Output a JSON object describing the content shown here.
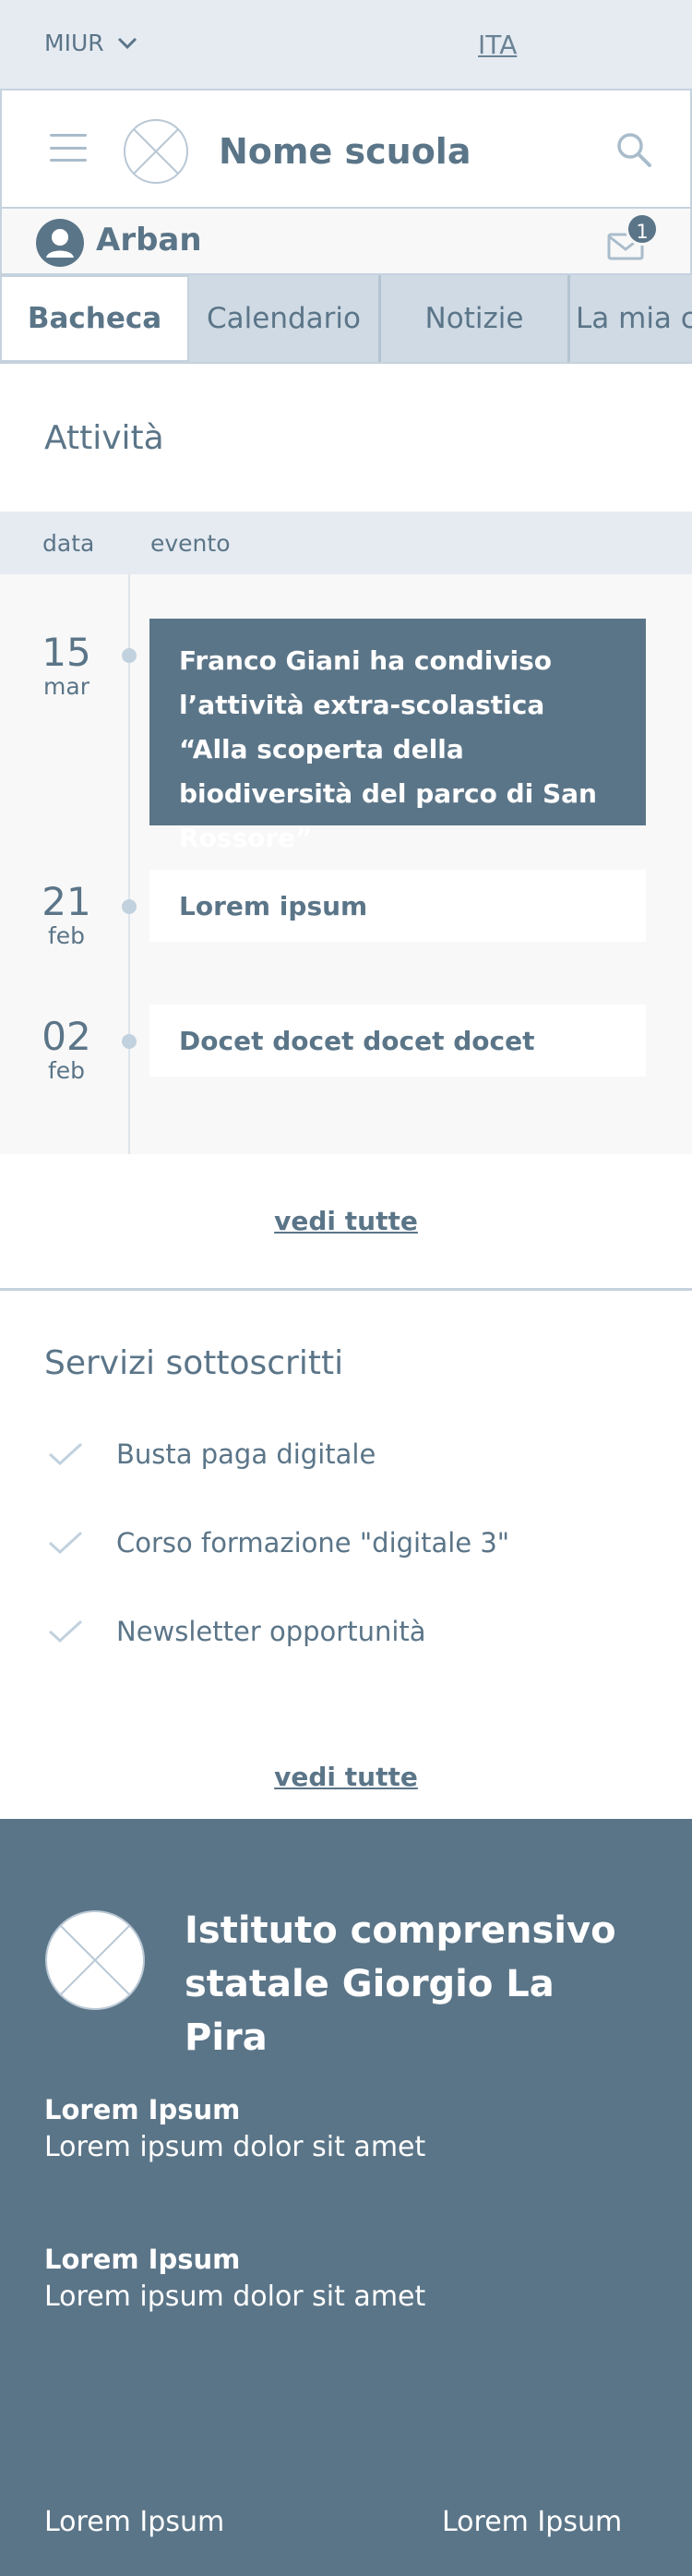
{
  "topbar": {
    "org_label": "MIUR",
    "language": "ITA"
  },
  "header": {
    "school_name": "Nome scuola"
  },
  "user": {
    "name": "Arban",
    "unread_count": "1"
  },
  "tabs": [
    {
      "label": "Bacheca",
      "active": true
    },
    {
      "label": "Calendario",
      "active": false
    },
    {
      "label": "Notizie",
      "active": false
    },
    {
      "label": "La mia classe",
      "active": false
    }
  ],
  "activity": {
    "title": "Attività",
    "col_date": "data",
    "col_event": "evento",
    "events": [
      {
        "day": "15",
        "month": "mar",
        "text": "Franco Giani ha condiviso l’attività extra-scolastica “Alla scoperta della biodiversità del parco di San Rossore”",
        "highlighted": true
      },
      {
        "day": "21",
        "month": "feb",
        "text": "Lorem ipsum",
        "highlighted": false
      },
      {
        "day": "02",
        "month": "feb",
        "text": "Docet docet docet docet",
        "highlighted": false
      }
    ],
    "see_all": "vedi tutte"
  },
  "services": {
    "title": "Servizi sottoscritti",
    "items": [
      "Busta paga digitale",
      "Corso formazione \"digitale 3\"",
      "Newsletter opportunità"
    ],
    "see_all": "vedi tutte"
  },
  "footer": {
    "institute_name": "Istituto comprensivo statale Giorgio La Pira",
    "blocks": [
      {
        "heading": "Lorem Ipsum",
        "text": "Lorem ipsum dolor sit amet"
      },
      {
        "heading": "Lorem Ipsum",
        "text": "Lorem ipsum dolor sit amet"
      }
    ],
    "links": [
      "Lorem Ipsum",
      "Lorem Ipsum"
    ]
  },
  "colors": {
    "primary": "#5b7588",
    "light_bg": "#e6ebf2",
    "tab_bg": "#cfdae4",
    "border": "#c5d2de"
  }
}
